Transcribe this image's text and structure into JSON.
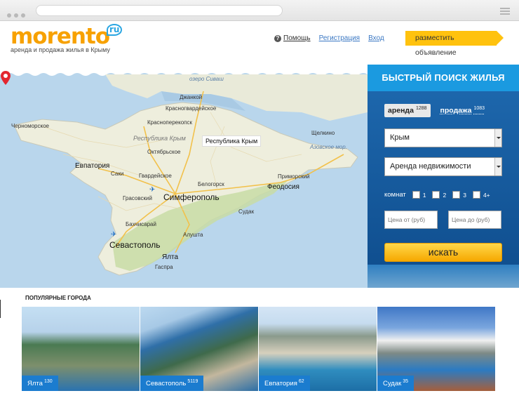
{
  "browser": {
    "menu_icon": "hamburger-icon"
  },
  "header": {
    "logo_text": "morento",
    "logo_ru": "ru",
    "tagline": "аренда и продажа жилья в Крыму",
    "help": "Помощь",
    "register": "Регистрация",
    "login": "Вход",
    "post_ad": "разместить объявление"
  },
  "map": {
    "marker_label": "Республика Крым",
    "cities_big": [
      "Симферополь"
    ],
    "labels": {
      "chernomorskoe": "Черноморское",
      "dzhankoy": "Джанкой",
      "krasnogvardeyskoe": "Красногвардейское",
      "krasnoperekopsk": "Красноперекопск",
      "oktyabrskoe": "Октябрьское",
      "evpatoria": "Евпатория",
      "saki": "Саки",
      "gvardeyskoe": "Гвардейское",
      "grasovskiy": "Грасовский",
      "simferopol": "Симферополь",
      "belogorsk": "Белогорск",
      "feodosia": "Феодосия",
      "primorskiy": "Приморский",
      "shchelkino": "Щелкино",
      "sudak": "Судак",
      "bakhchisaray": "Бахчисарай",
      "sevastopol": "Севастополь",
      "alushta": "Алушта",
      "yalta": "Ялта",
      "gaspra": "Гаспра",
      "lake_sivash": "озеро Сиваш",
      "region": "Республика Крым",
      "azov": "Азовское мор."
    }
  },
  "search": {
    "title": "БЫСТРЫЙ ПОИСК ЖИЛЬЯ",
    "tab_rent": "аренда",
    "tab_rent_count": "1288",
    "tab_sale": "продажа",
    "tab_sale_count": "1083",
    "region_value": "Крым",
    "type_value": "Аренда недвижимости",
    "rooms_label": "комнат",
    "rooms": [
      "1",
      "2",
      "3",
      "4+"
    ],
    "price_from_placeholder": "Цена от (руб)",
    "price_to_placeholder": "Цена до (руб)",
    "submit": "искать"
  },
  "popular": {
    "title": "ПОПУЛЯРНЫЕ ГОРОДА",
    "cities": [
      {
        "name": "Ялта",
        "count": "130"
      },
      {
        "name": "Севастополь",
        "count": "5119"
      },
      {
        "name": "Евпатория",
        "count": "62"
      },
      {
        "name": "Судак",
        "count": "35"
      }
    ]
  },
  "colors": {
    "accent": "#f7a100",
    "blue": "#1b9ae0",
    "button": "#ffc20e"
  }
}
